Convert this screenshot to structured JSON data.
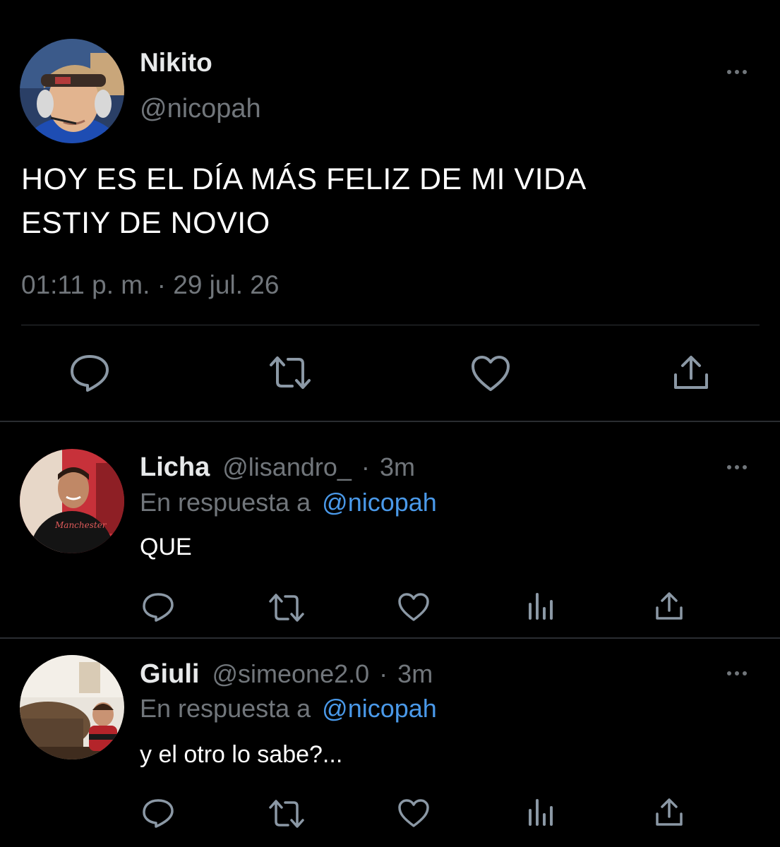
{
  "main_tweet": {
    "display_name": "Nikito",
    "handle": "@nicopah",
    "text_line1": "HOY ES EL DÍA MÁS FELIZ DE MI VIDA",
    "text_line2": "ESTIY DE NOVIO",
    "timestamp": "01:11 p. m. · 29 jul. 26",
    "avatar_icon": "person-with-headset-avatar",
    "actions": [
      "reply-icon",
      "retweet-icon",
      "like-icon",
      "share-icon"
    ]
  },
  "replies": [
    {
      "display_name": "Licha",
      "handle": "@lisandro_",
      "time_sep": "·",
      "time": "3m",
      "reply_prefix": "En respuesta a",
      "reply_to": "@nicopah",
      "text": "QUE",
      "avatar_icon": "person-smiling-avatar",
      "actions": [
        "reply-icon",
        "retweet-icon",
        "like-icon",
        "analytics-icon",
        "share-icon"
      ]
    },
    {
      "display_name": "Giuli",
      "handle": "@simeone2.0",
      "time_sep": "·",
      "time": "3m",
      "reply_prefix": "En respuesta a",
      "reply_to": "@nicopah",
      "text": "y el otro lo sabe?...",
      "avatar_icon": "child-on-sofa-avatar",
      "actions": [
        "reply-icon",
        "retweet-icon",
        "like-icon",
        "analytics-icon",
        "share-icon"
      ]
    }
  ],
  "colors": {
    "background": "#000000",
    "text": "#e7e9ea",
    "muted": "#71767b",
    "link": "#4a99e9",
    "divider": "#2f3336"
  }
}
